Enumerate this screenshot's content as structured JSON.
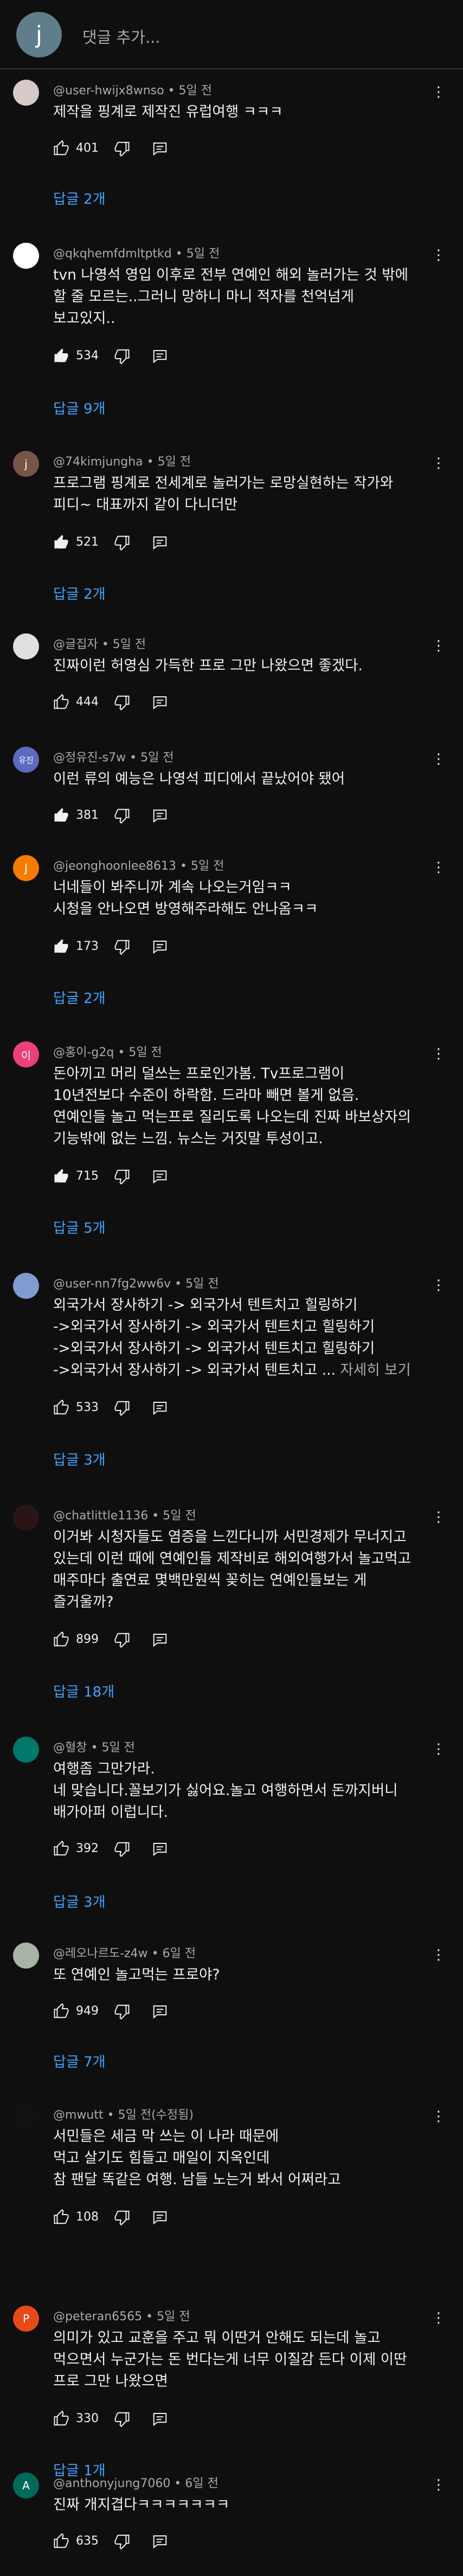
{
  "composer": {
    "avatar_letter": "j",
    "placeholder": "댓글 추가..."
  },
  "icons": {
    "like": "thumbs-up-icon",
    "dislike": "thumbs-down-icon",
    "reply": "reply-icon",
    "more": "more-vertical-icon"
  },
  "comments": [
    {
      "author": "@user-hwijx8wnso",
      "time": "5일 전",
      "edited": "",
      "text": "제작을 핑계로 제작진 유럽여행 ㅋㅋㅋ",
      "likes": "401",
      "liked": false,
      "replies": "답글 2개",
      "avatar_color": "#d8c9c9",
      "avatar_letter": ""
    },
    {
      "author": "@qkqhemfdmltptkd",
      "time": "5일 전",
      "edited": "",
      "text": "tvn 나영석 영입 이후로 전부 연예인 해외 놀러가는 것 밖에\n할 줄 모르는..그러니 망하니 마니 적자를 천억넘게\n보고있지..",
      "likes": "534",
      "liked": true,
      "replies": "답글 9개",
      "avatar_color": "#ffffff",
      "avatar_letter": ""
    },
    {
      "author": "@74kimjungha",
      "time": "5일 전",
      "edited": "",
      "text": "프로그램 핑계로 전세계로 놀러가는 로망실현하는 작가와\n피디~ 대표까지 같이 다니더만",
      "likes": "521",
      "liked": true,
      "replies": "답글 2개",
      "avatar_color": "#795548",
      "avatar_letter": "j"
    },
    {
      "author": "@글집자",
      "time": "5일 전",
      "edited": "",
      "text": "진짜이런 허영심 가득한 프로 그만 나왔으면 좋겠다.",
      "likes": "444",
      "liked": false,
      "replies": "",
      "avatar_color": "#e0e0e0",
      "avatar_letter": ""
    },
    {
      "author": "@정유진-s7w",
      "time": "5일 전",
      "edited": "",
      "text": "이런 류의 예능은 나영석 피디에서 끝났어야 됐어",
      "likes": "381",
      "liked": true,
      "replies": "",
      "avatar_color": "#5c6bc0",
      "avatar_letter": "유진"
    },
    {
      "author": "@jeonghoonlee8613",
      "time": "5일 전",
      "edited": "",
      "text": "너네들이 봐주니까 계속 나오는거임ㅋㅋ\n시청을 안나오면 방영해주라해도 안나옴ㅋㅋ",
      "likes": "173",
      "liked": true,
      "replies": "답글 2개",
      "avatar_color": "#f57c00",
      "avatar_letter": "J"
    },
    {
      "author": "@홍이-g2q",
      "time": "5일 전",
      "edited": "",
      "text": "돈아끼고 머리 덜쓰는 프로인가봄. Tv프로그램이\n10년전보다 수준이 하락함. 드라마 빼면 볼게 없음.\n연예인들 놀고 먹는프로 질리도록 나오는데 진짜 바보상자의\n기능밖에 없는 느낌. 뉴스는 거짓말 투성이고.",
      "likes": "715",
      "liked": true,
      "replies": "답글 5개",
      "avatar_color": "#ec407a",
      "avatar_letter": "이"
    },
    {
      "author": "@user-nn7fg2ww6v",
      "time": "5일 전",
      "edited": "",
      "text": "외국가서 장사하기 -> 외국가서 텐트치고 힐링하기\n->외국가서 장사하기 -> 외국가서 텐트치고 힐링하기\n->외국가서 장사하기 -> 외국가서 텐트치고 힐링하기\n->외국가서 장사하기 -> 외국가서 텐트치고 ...",
      "more": "자세히 보기",
      "likes": "533",
      "liked": false,
      "replies": "답글 3개",
      "avatar_color": "#7e9ccf",
      "avatar_letter": ""
    },
    {
      "author": "@chatlittle1136",
      "time": "5일 전",
      "edited": "",
      "text": "이거봐 시청자들도 염증을 느낀다니까 서민경제가 무너지고\n있는데 이런 때에 연예인들 제작비로 해외여행가서 놀고먹고\n매주마다 출연료 몇백만원씩 꽂히는 연예인들보는 게\n즐거울까?",
      "likes": "899",
      "liked": false,
      "replies": "답글 18개",
      "avatar_color": "#2b1416",
      "avatar_letter": ""
    },
    {
      "author": "@혈창",
      "time": "5일 전",
      "edited": "",
      "text": "여행좀 그만가라.\n네 맞습니다.꼴보기가 싫어요.놀고 여행하면서 돈까지버니\n배가아퍼 이럽니다.",
      "likes": "392",
      "liked": false,
      "replies": "답글 3개",
      "avatar_color": "#00796b",
      "avatar_letter": ""
    },
    {
      "author": "@레오나르도-z4w",
      "time": "6일 전",
      "edited": "",
      "text": "또 연예인 놀고먹는 프로야?",
      "likes": "949",
      "liked": false,
      "replies": "답글 7개",
      "avatar_color": "#a7b3a5",
      "avatar_letter": ""
    },
    {
      "author": "@mwutt",
      "time": "5일 전",
      "edited": "(수정됨)",
      "text": "서민들은 세금 막 쓰는 이 나라 때문에\n먹고 살기도 힘들고 매일이 지옥인데\n참 팬달 똑같은 여행. 남들 노는거 봐서 어쩌라고",
      "likes": "108",
      "liked": false,
      "replies": "",
      "avatar_color": "#111111",
      "avatar_letter": ""
    },
    {
      "author": "@peteran6565",
      "time": "5일 전",
      "edited": "",
      "text": "의미가 있고 교훈을 주고 뭐 이딴거 안해도 되는데 놀고\n먹으면서 누군가는 돈 번다는게 너무 이질감 든다 이제 이딴\n프로 그만 나왔으면",
      "likes": "330",
      "liked": false,
      "replies": "답글 1개",
      "avatar_color": "#e64a19",
      "avatar_letter": "P"
    },
    {
      "author": "@anthonyjung7060",
      "time": "6일 전",
      "edited": "",
      "text": "진짜 개지겹다ㅋㅋㅋㅋㅋㅋㅋ",
      "likes": "635",
      "liked": false,
      "replies": "",
      "avatar_color": "#00695c",
      "avatar_letter": "A"
    }
  ]
}
